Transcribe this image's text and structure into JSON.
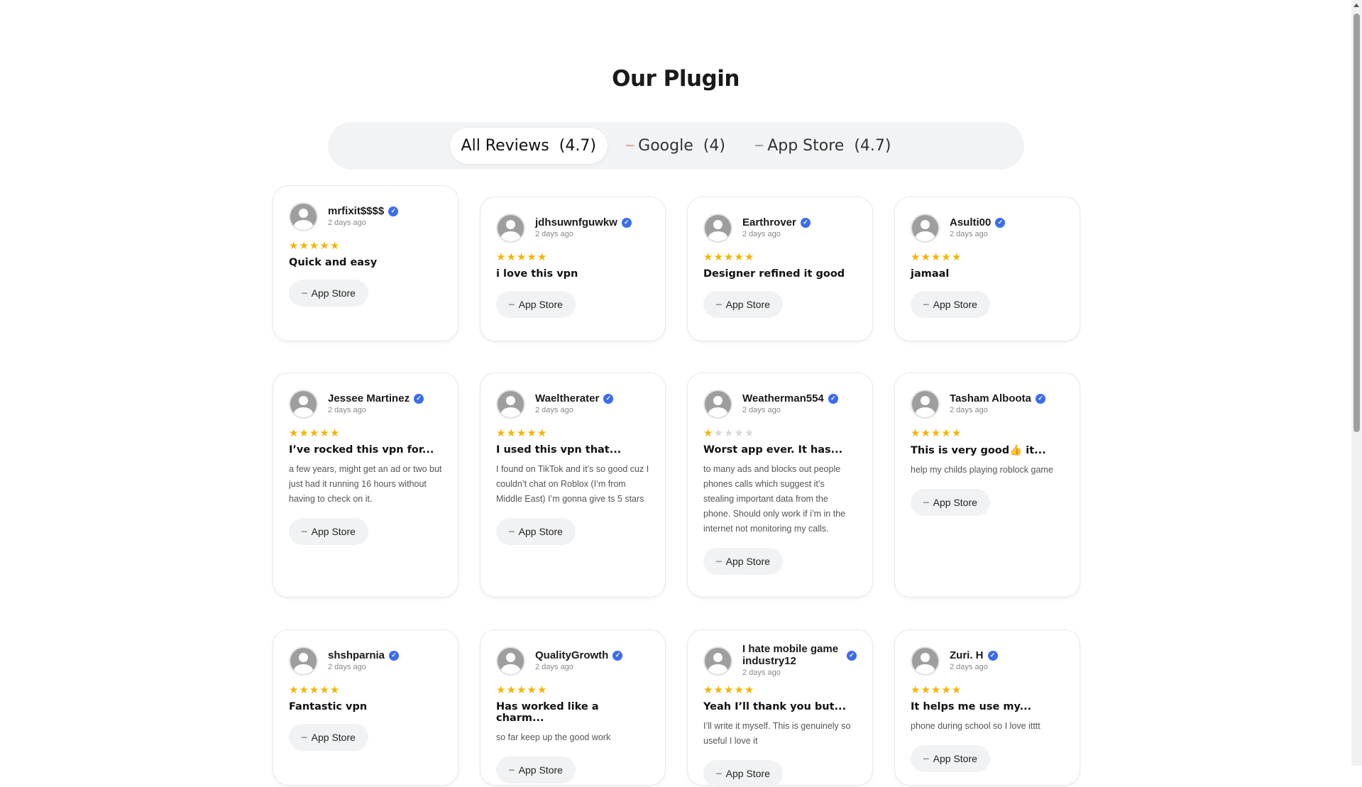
{
  "page": {
    "title": "Our Plugin"
  },
  "tabs": [
    {
      "label": "All Reviews",
      "count": "(4.7)",
      "icon": "all-icon",
      "active": true
    },
    {
      "label": "Google",
      "count": "(4)",
      "icon": "google-icon",
      "active": false
    },
    {
      "label": "App Store",
      "count": "(4.7)",
      "icon": "app-store-icon",
      "active": false
    }
  ],
  "reviews": [
    {
      "name": "mrfixit$$$$",
      "time": "2 days ago",
      "rating": 5,
      "title": "Quick and easy",
      "body": "",
      "source": "App Store"
    },
    {
      "name": "jdhsuwnfguwkw",
      "time": "2 days ago",
      "rating": 5,
      "title": "i love this vpn",
      "body": "",
      "source": "App Store"
    },
    {
      "name": "Earthrover",
      "time": "2 days ago",
      "rating": 5,
      "title": "Designer refined it good",
      "body": "",
      "source": "App Store"
    },
    {
      "name": "Asulti00",
      "time": "2 days ago",
      "rating": 5,
      "title": "jamaal",
      "body": "",
      "source": "App Store"
    },
    {
      "name": "Jessee Martinez",
      "time": "2 days ago",
      "rating": 5,
      "title": "I’ve rocked this vpn for...",
      "body": "a few years, might get an ad or two but just had it running 16 hours without having to check on it.",
      "source": "App Store"
    },
    {
      "name": "Waeltherater",
      "time": "2 days ago",
      "rating": 5,
      "title": "I used this vpn that...",
      "body": "I found on TikTok and it’s so good cuz I couldn’t chat on Roblox (I’m from Middle East) I’m gonna give ts 5 stars",
      "source": "App Store"
    },
    {
      "name": "Weatherman554",
      "time": "2 days ago",
      "rating": 1,
      "title": "Worst app ever. It has...",
      "body": "to many ads and blocks out people phones calls which suggest it’s stealing important data from the phone. Should only work if i’m in the internet not monitoring my calls.",
      "source": "App Store"
    },
    {
      "name": "Tasham Alboota",
      "time": "2 days ago",
      "rating": 5,
      "title": "This is very good👍 it...",
      "body": "help my childs playing roblock game",
      "source": "App Store"
    },
    {
      "name": "shshparnia",
      "time": "2 days ago",
      "rating": 5,
      "title": "Fantastic vpn",
      "body": "",
      "source": "App Store"
    },
    {
      "name": "QualityGrowth",
      "time": "2 days ago",
      "rating": 5,
      "title": "Has worked like a charm...",
      "body": "so far keep up the good work",
      "source": "App Store"
    },
    {
      "name": "I hate mobile game industry12",
      "time": "2 days ago",
      "rating": 5,
      "title": "Yeah I’ll thank you but...",
      "body": "I’ll write it myself. This is genuinely so useful I love it",
      "source": "App Store"
    },
    {
      "name": "Zuri. H",
      "time": "2 days ago",
      "rating": 5,
      "title": "It helps me use my...",
      "body": "phone during school so I love itttt",
      "source": "App Store"
    }
  ],
  "colors": {
    "star": "#f5b400",
    "verified": "#3b6cf0",
    "tab_bar": "#f1f3f5"
  }
}
